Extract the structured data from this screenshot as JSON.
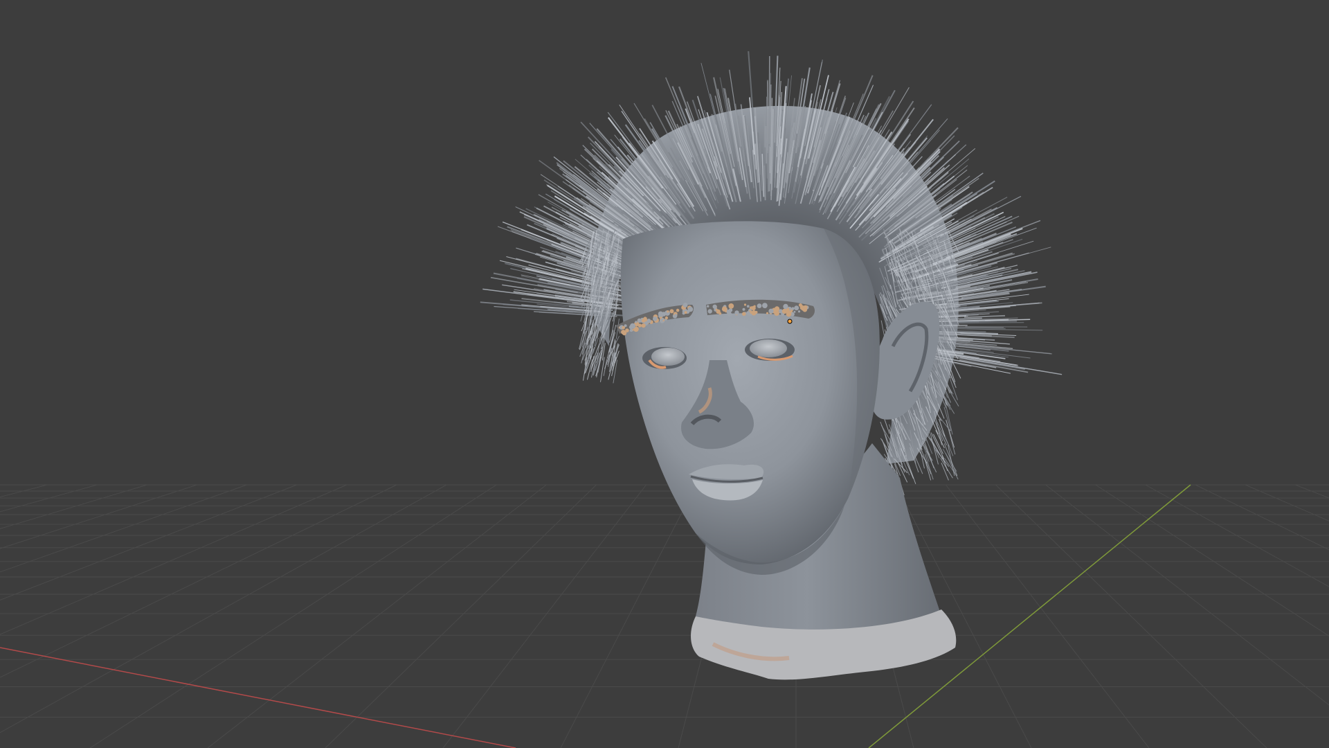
{
  "app": {
    "name": "3D viewport",
    "view": "perspective"
  },
  "viewport": {
    "background_color": "#3d3d3d",
    "grid_line_color": "#4a4a4a",
    "x_axis_color": "#b34a4a",
    "y_axis_color": "#7f9a3a"
  },
  "scene": {
    "objects": [
      {
        "name": "head-mesh",
        "material_color": "#8f959d",
        "hair": "particle-hair",
        "hair_color": "#a4aab2",
        "selected": false
      }
    ],
    "origin_marker_color": "#ffa640"
  }
}
